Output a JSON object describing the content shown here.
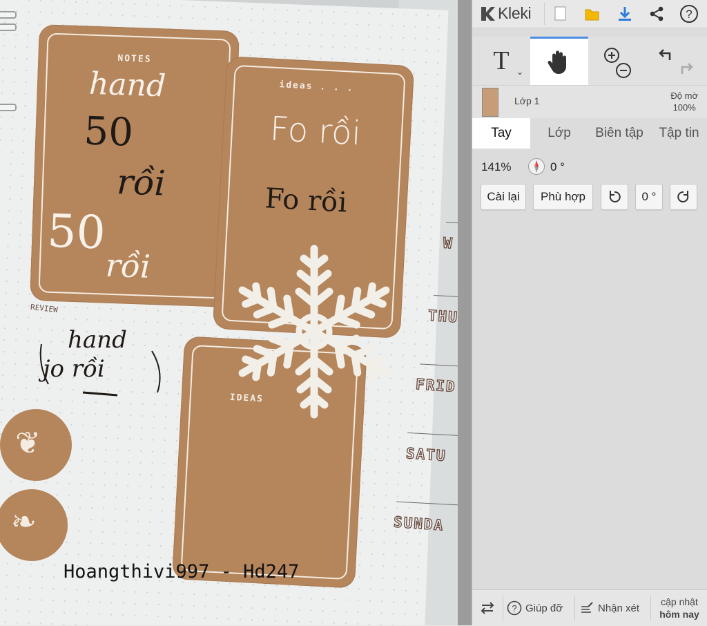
{
  "app": {
    "name": "Kleki",
    "accent": "#4a8ee6"
  },
  "topbar": {
    "icons": [
      "kleki-logo-icon",
      "new-file-icon",
      "open-folder-icon",
      "download-icon",
      "share-icon",
      "help-icon"
    ]
  },
  "tools": {
    "text_label": "T",
    "active_tool": "hand",
    "icons": [
      "text-tool-icon",
      "hand-tool-icon",
      "zoom-in-icon",
      "zoom-out-icon",
      "undo-icon",
      "redo-icon"
    ]
  },
  "layer": {
    "name": "Lớp 1",
    "opacity_label": "Độ mờ",
    "opacity_value": "100%"
  },
  "tabs": [
    {
      "label": "Tay",
      "active": true
    },
    {
      "label": "Lớp",
      "active": false
    },
    {
      "label": "Biên tập",
      "active": false
    },
    {
      "label": "Tập tin",
      "active": false
    }
  ],
  "hand_panel": {
    "zoom": "141%",
    "angle": "0 °",
    "reset_label": "Cài lại",
    "fit_label": "Phù hợp",
    "rotation_value": "0 °"
  },
  "bottombar": {
    "help_label": "Giúp đỡ",
    "feedback_label": "Nhận xét",
    "update_line1": "cập nhật",
    "update_line2": "hôm nay"
  },
  "canvas": {
    "card1_label": "NOTES",
    "card1_line1": "hand",
    "card1_line2": "50",
    "card1_line3": "rồi",
    "card1_line4": "50",
    "card1_line5": "rồi",
    "card2_label": "ideas . . .",
    "card2_line1": "Fo rồi",
    "card2_line2": "Fo rồi",
    "card3_label": "IDEAS",
    "review_label": "REVIEW",
    "review_line1": "hand",
    "review_line2": "jo rồi",
    "days": [
      "W",
      "THU",
      "FRID",
      "SATU",
      "SUNDA"
    ],
    "watermark": "Hoangthivi997 - Hd247"
  }
}
